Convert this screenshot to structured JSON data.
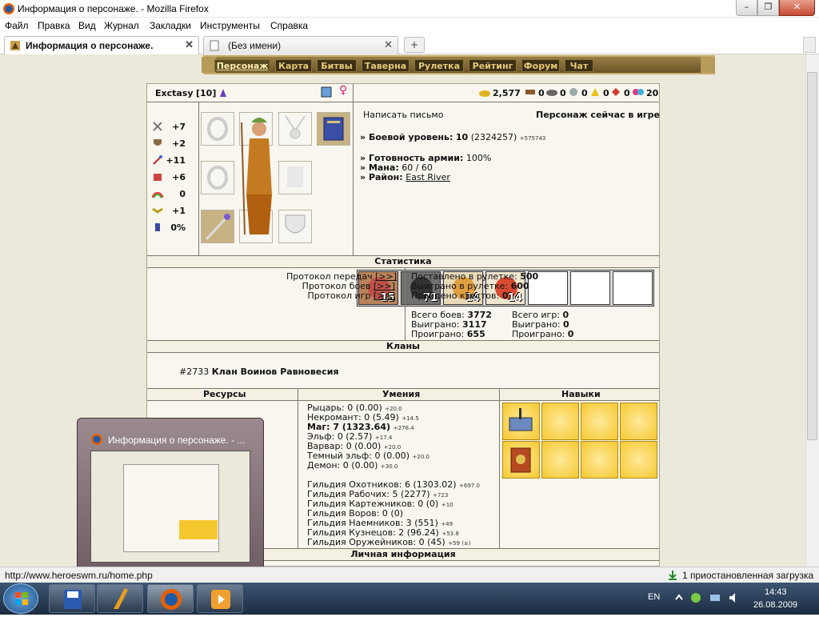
{
  "window": {
    "title": "Информация о персонаже. - Mozilla Firefox",
    "min": "–",
    "max": "❐",
    "close": "✕"
  },
  "menu": [
    "Файл",
    "Правка",
    "Вид",
    "Журнал",
    "Закладки",
    "Инструменты",
    "Справка"
  ],
  "tabs": [
    {
      "label": "Информация о персонаже.",
      "close": "✕"
    },
    {
      "label": "(Без имени)",
      "close": "✕"
    }
  ],
  "new_tab": "+",
  "nav": [
    "Персонаж",
    "Карта",
    "Битвы",
    "Таверна",
    "Рулетка",
    "Рейтинг",
    "Форум",
    "Чат"
  ],
  "hero": {
    "name": "Exctasy",
    "level": "[10]",
    "resources": [
      {
        "icon": "gold-icon",
        "value": "2,577"
      },
      {
        "icon": "wood-icon",
        "value": "0"
      },
      {
        "icon": "ore-icon",
        "value": "0"
      },
      {
        "icon": "mercury-icon",
        "value": "0"
      },
      {
        "icon": "sulfur-icon",
        "value": "0"
      },
      {
        "icon": "crystal-icon",
        "value": "0"
      },
      {
        "icon": "gems-icon",
        "value": "20"
      }
    ],
    "stats": [
      {
        "icon": "attack-icon",
        "value": "+7"
      },
      {
        "icon": "defense-icon",
        "value": "+2"
      },
      {
        "icon": "spellpower-icon",
        "value": "+11"
      },
      {
        "icon": "knowledge-icon",
        "value": "+6"
      },
      {
        "icon": "luck-icon",
        "value": "0"
      },
      {
        "icon": "morale-icon",
        "value": "+1"
      },
      {
        "icon": "potion-icon",
        "value": "0%"
      }
    ],
    "write_letter": "Написать письмо",
    "online_status": "Персонаж сейчас в игре",
    "combat_level_label": "Боевой уровень:",
    "combat_level": "10",
    "combat_exp": "(2324257)",
    "combat_exp_small": "+575743",
    "army_label": "Готовность армии:",
    "army_value": "100%",
    "mana_label": "Мана:",
    "mana_value": "60 / 60",
    "district_label": "Район:",
    "district_value": "East River",
    "units": [
      {
        "name": "unit-demon",
        "count": "15"
      },
      {
        "name": "unit-warrior",
        "count": "71"
      },
      {
        "name": "unit-mage",
        "count": "14"
      },
      {
        "name": "unit-priest",
        "count": "14"
      },
      {
        "name": "unit-empty",
        "count": ""
      },
      {
        "name": "unit-empty",
        "count": ""
      },
      {
        "name": "unit-empty",
        "count": ""
      }
    ]
  },
  "statistics": {
    "header": "Статистика",
    "protocols": [
      {
        "label": "Протокол передач",
        "link": "[>>]"
      },
      {
        "label": "Протокол боев",
        "link": "[>>]"
      },
      {
        "label": "Протокол игр",
        "link": "[>>]"
      }
    ],
    "roulette_bet_label": "Поставлено в рулетке:",
    "roulette_bet": "500",
    "roulette_won_label": "Выиграно в рулетке:",
    "roulette_won": "600",
    "quests_label": "Пройдено квестов:",
    "quests": "0",
    "battles_total_label": "Всего боев:",
    "battles_total": "3772",
    "battles_won_label": "Выиграно:",
    "battles_won": "3117",
    "battles_lost_label": "Проиграно:",
    "battles_lost": "655",
    "games_total_label": "Всего игр:",
    "games_total": "0",
    "games_won_label": "Выиграно:",
    "games_won": "0",
    "games_lost_label": "Проиграно:",
    "games_lost": "0"
  },
  "clans": {
    "header": "Кланы",
    "clan_id": "#2733",
    "clan_name": "Клан Воинов Равновесия"
  },
  "bottom": {
    "resources_header": "Ресурсы",
    "skills_header": "Умения",
    "abilities_header": "Навыки",
    "personal_header": "Личная информация",
    "skills": [
      {
        "name": "Рыцарь:",
        "value": "0 (0.00)",
        "small": "+20.0",
        "bold": false
      },
      {
        "name": "Некромант:",
        "value": "0 (5.49)",
        "small": "+14.5",
        "bold": false
      },
      {
        "name": "Маг:",
        "value": "7 (1323.64)",
        "small": "+276.4",
        "bold": true
      },
      {
        "name": "Эльф:",
        "value": "0 (2.57)",
        "small": "+17.4",
        "bold": false
      },
      {
        "name": "Варвар:",
        "value": "0 (0.00)",
        "small": "+20.0",
        "bold": false
      },
      {
        "name": "Темный эльф:",
        "value": "0 (0.00)",
        "small": "+20.0",
        "bold": false
      },
      {
        "name": "Демон:",
        "value": "0 (0.00)",
        "small": "+30.0",
        "bold": false
      }
    ],
    "guilds": [
      {
        "name": "Гильдия Охотников:",
        "value": "6 (1303.02)",
        "small": "+697.0"
      },
      {
        "name": "Гильдия Рабочих:",
        "value": "5 (2277)",
        "small": "+723"
      },
      {
        "name": "Гильдия Картежников:",
        "value": "0 (0)",
        "small": "+10"
      },
      {
        "name": "Гильдия Воров:",
        "value": "0 (0)",
        "small": ""
      },
      {
        "name": "Гильдия Наемников:",
        "value": "3 (551)",
        "small": "+49"
      },
      {
        "name": "Гильдия Кузнецов:",
        "value": "2 (96.24)",
        "small": "+53.8"
      },
      {
        "name": "Гильдия Оружейников:",
        "value": "0 (45)",
        "small": "+59 (±)"
      }
    ]
  },
  "preview": {
    "title": "Информация о персонаже. - ..."
  },
  "statusbar": {
    "url": "http://www.heroeswm.ru/home.php",
    "downloads": "1 приостановленная загрузка"
  },
  "tray": {
    "lang": "EN",
    "time": "14:43",
    "date": "26.08.2009"
  }
}
